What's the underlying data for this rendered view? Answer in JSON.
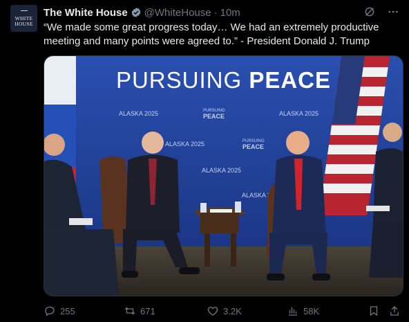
{
  "account": {
    "name": "The White House",
    "handle": "@WhiteHouse",
    "separator": "·",
    "time": "10m",
    "avatar_line1": "WHITE",
    "avatar_line2": "HOUSE"
  },
  "tweet": {
    "text": "“We made some great progress today… We had an extremely productive meeting and many points were agreed to.” - President Donald J. Trump"
  },
  "media": {
    "banner_light": "PURSUING ",
    "banner_bold": "PEACE",
    "backdrop_texts": [
      "ALASKA 2025",
      "PURSUING",
      "PEACE"
    ]
  },
  "actions": {
    "replies": "255",
    "reposts": "671",
    "likes": "3.2K",
    "views": "58K"
  },
  "colors": {
    "background": "#000000",
    "text": "#e7e9ea",
    "muted": "#71767b",
    "verified": "#829aab",
    "backdrop_blue": "#1f3f95"
  },
  "icons": {
    "verified": "verified-badge-icon",
    "grok": "grok-icon",
    "more": "more-icon",
    "reply": "reply-icon",
    "repost": "repost-icon",
    "like": "heart-icon",
    "views": "views-icon",
    "bookmark": "bookmark-icon",
    "share": "share-icon"
  }
}
